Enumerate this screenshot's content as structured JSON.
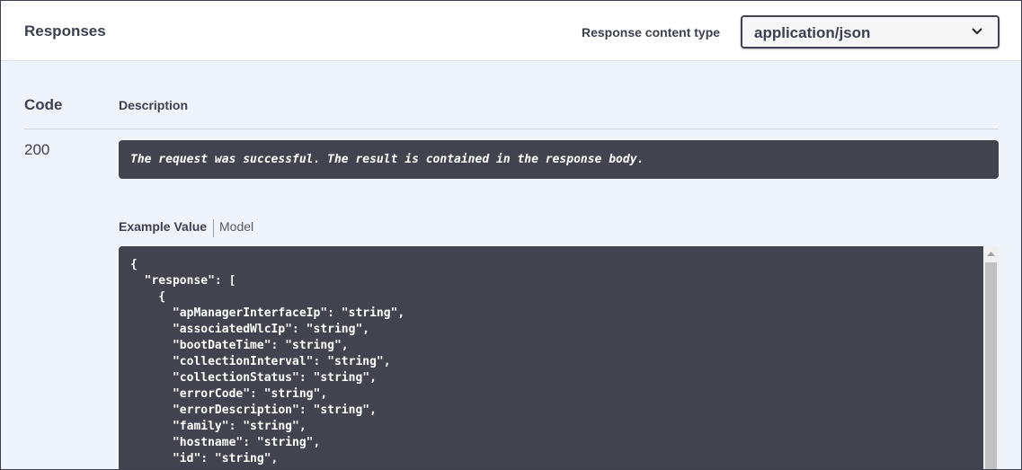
{
  "header": {
    "title": "Responses",
    "content_type_label": "Response content type",
    "content_type_value": "application/json"
  },
  "table": {
    "code_header": "Code",
    "description_header": "Description"
  },
  "row": {
    "code": "200",
    "description": "The request was successful. The result is contained in the response body."
  },
  "tabs": {
    "example_value": "Example Value",
    "model": "Model"
  },
  "example_json": "{\n  \"response\": [\n    {\n      \"apManagerInterfaceIp\": \"string\",\n      \"associatedWlcIp\": \"string\",\n      \"bootDateTime\": \"string\",\n      \"collectionInterval\": \"string\",\n      \"collectionStatus\": \"string\",\n      \"errorCode\": \"string\",\n      \"errorDescription\": \"string\",\n      \"family\": \"string\",\n      \"hostname\": \"string\",\n      \"id\": \"string\",",
  "icons": {
    "select": "chevron-down-icon",
    "scroll_up": "arrow-up-icon"
  },
  "colors": {
    "text": "#3b4151",
    "code_bg": "#41444e",
    "panel_bg": "#eef4fa"
  }
}
